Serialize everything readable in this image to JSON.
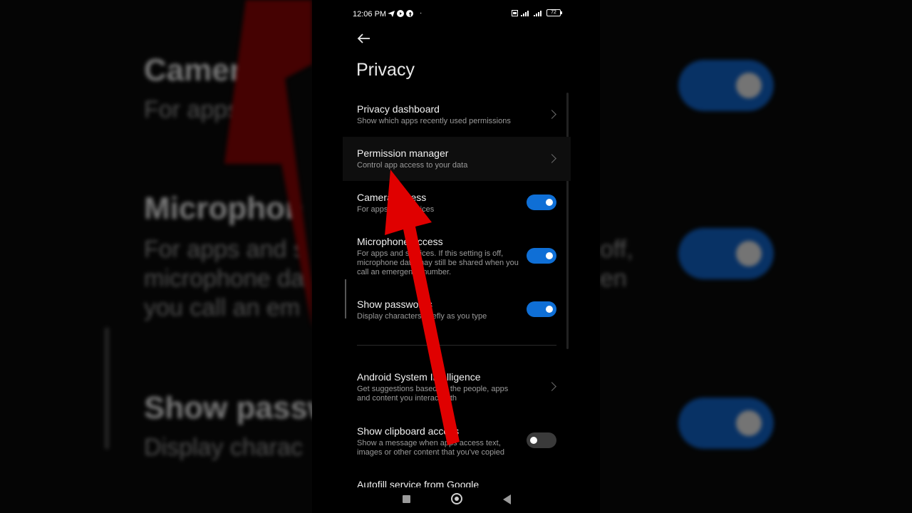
{
  "status_bar": {
    "time": "12:06 PM",
    "battery": "72"
  },
  "page": {
    "title": "Privacy"
  },
  "settings": [
    {
      "title": "Privacy dashboard",
      "subtitle": "Show which apps recently used permissions",
      "control": "chevron"
    },
    {
      "title": "Permission manager",
      "subtitle": "Control app access to your data",
      "control": "chevron"
    },
    {
      "title": "Camera access",
      "subtitle": "For apps and services",
      "control": "toggle",
      "state": "on"
    },
    {
      "title": "Microphone access",
      "subtitle": "For apps and services. If this setting is off, microphone data may still be shared when you call an emergency number.",
      "control": "toggle",
      "state": "on"
    },
    {
      "title": "Show passwords",
      "subtitle": "Display characters briefly as you type",
      "control": "toggle",
      "state": "on"
    },
    {
      "title": "Android System Intelligence",
      "subtitle": "Get suggestions based on the people, apps and content you interact with",
      "control": "chevron"
    },
    {
      "title": "Show clipboard access",
      "subtitle": "Show a message when apps access text, images or other content that you've copied",
      "control": "toggle",
      "state": "off"
    },
    {
      "title": "Autofill service from Google",
      "subtitle": "",
      "control": "none"
    }
  ],
  "background": {
    "camera_title": "Camer",
    "camera_sub": "For apps",
    "mic_title": "Microphon",
    "mic_sub_1": "For apps and s",
    "mic_sub_2": "microphone da",
    "mic_sub_3": "you call an em",
    "right_sub_1": "off,",
    "right_sub_2": "en",
    "pw_title": "Show passw",
    "pw_sub": "Display charac"
  },
  "colors": {
    "toggle_on": "#0f6fd6",
    "arrow": "#e00000"
  },
  "icons": [
    "telegram-icon",
    "youtube-icon",
    "facebook-icon",
    "sim-icon",
    "signal-icon",
    "battery-icon",
    "back-arrow-icon",
    "chevron-right-icon"
  ]
}
